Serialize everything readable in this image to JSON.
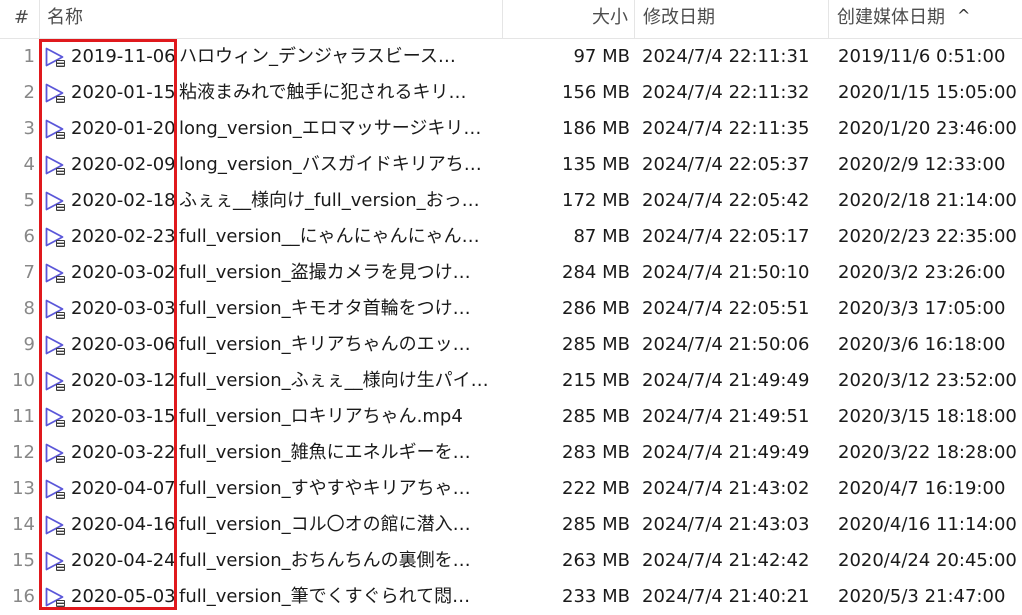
{
  "header": {
    "index_label": "#",
    "name_label": "名称",
    "size_label": "大小",
    "modified_label": "修改日期",
    "created_label": "创建媒体日期",
    "sort_indicator": "^"
  },
  "icon": {
    "name": "video-file-icon",
    "accent": "#5b57d9"
  },
  "highlight": {
    "color": "#e0191d"
  },
  "rows": [
    {
      "index": "1",
      "date": "2019-11-06",
      "title": "ハロウィン_デンジャラスビース…",
      "size": "97 MB",
      "modified": "2024/7/4 22:11:31",
      "created": "2019/11/6 0:51:00"
    },
    {
      "index": "2",
      "date": "2020-01-15",
      "title": "粘液まみれで触手に犯されるキリ…",
      "size": "156 MB",
      "modified": "2024/7/4 22:11:32",
      "created": "2020/1/15 15:05:00"
    },
    {
      "index": "3",
      "date": "2020-01-20",
      "title": "long_version_エロマッサージキリ…",
      "size": "186 MB",
      "modified": "2024/7/4 22:11:35",
      "created": "2020/1/20 23:46:00"
    },
    {
      "index": "4",
      "date": "2020-02-09",
      "title": "long_version_バスガイドキリアち…",
      "size": "135 MB",
      "modified": "2024/7/4 22:05:37",
      "created": "2020/2/9 12:33:00"
    },
    {
      "index": "5",
      "date": "2020-02-18",
      "title": "ふぇぇ__様向け_full_version_おっ…",
      "size": "172 MB",
      "modified": "2024/7/4 22:05:42",
      "created": "2020/2/18 21:14:00"
    },
    {
      "index": "6",
      "date": "2020-02-23",
      "title": "full_version__にゃんにゃんにゃん…",
      "size": "87 MB",
      "modified": "2024/7/4 22:05:17",
      "created": "2020/2/23 22:35:00"
    },
    {
      "index": "7",
      "date": "2020-03-02",
      "title": "full_version_盗撮カメラを見つけ…",
      "size": "284 MB",
      "modified": "2024/7/4 21:50:10",
      "created": "2020/3/2 23:26:00"
    },
    {
      "index": "8",
      "date": "2020-03-03",
      "title": "full_version_キモオタ首輪をつけ…",
      "size": "286 MB",
      "modified": "2024/7/4 22:05:51",
      "created": "2020/3/3 17:05:00"
    },
    {
      "index": "9",
      "date": "2020-03-06",
      "title": "full_version_キリアちゃんのエッ…",
      "size": "285 MB",
      "modified": "2024/7/4 21:50:06",
      "created": "2020/3/6 16:18:00"
    },
    {
      "index": "10",
      "date": "2020-03-12",
      "title": "full_version_ふぇぇ__様向け生パイ…",
      "size": "215 MB",
      "modified": "2024/7/4 21:49:49",
      "created": "2020/3/12 23:52:00"
    },
    {
      "index": "11",
      "date": "2020-03-15",
      "title": "full_version_ロキリアちゃん.mp4",
      "size": "285 MB",
      "modified": "2024/7/4 21:49:51",
      "created": "2020/3/15 18:18:00"
    },
    {
      "index": "12",
      "date": "2020-03-22",
      "title": "full_version_雑魚にエネルギーを…",
      "size": "283 MB",
      "modified": "2024/7/4 21:49:49",
      "created": "2020/3/22 18:28:00"
    },
    {
      "index": "13",
      "date": "2020-04-07",
      "title": "full_version_すやすやキリアちゃ…",
      "size": "222 MB",
      "modified": "2024/7/4 21:43:02",
      "created": "2020/4/7 16:19:00"
    },
    {
      "index": "14",
      "date": "2020-04-16",
      "title": "full_version_コル〇オの館に潜入…",
      "size": "285 MB",
      "modified": "2024/7/4 21:43:03",
      "created": "2020/4/16 11:14:00"
    },
    {
      "index": "15",
      "date": "2020-04-24",
      "title": "full_version_おちんちんの裏側を…",
      "size": "263 MB",
      "modified": "2024/7/4 21:42:42",
      "created": "2020/4/24 20:45:00"
    },
    {
      "index": "16",
      "date": "2020-05-03",
      "title": "full_version_筆でくすぐられて悶…",
      "size": "233 MB",
      "modified": "2024/7/4 21:40:21",
      "created": "2020/5/3 21:47:00"
    }
  ]
}
